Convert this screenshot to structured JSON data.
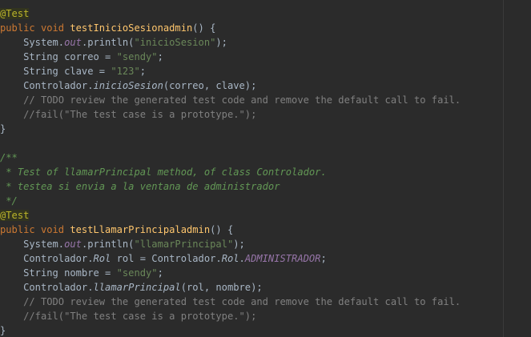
{
  "lines": [
    [
      {
        "t": "@Test",
        "c": "ann"
      }
    ],
    [
      {
        "t": "public void ",
        "c": "kw"
      },
      {
        "t": "testInicioSesionadmin",
        "c": "fn"
      },
      {
        "t": "() {",
        "c": ""
      }
    ],
    [
      {
        "t": "    System.",
        "c": ""
      },
      {
        "t": "out",
        "c": "fld"
      },
      {
        "t": ".println(",
        "c": ""
      },
      {
        "t": "\"inicioSesion\"",
        "c": "str"
      },
      {
        "t": ");",
        "c": ""
      }
    ],
    [
      {
        "t": "    String correo = ",
        "c": ""
      },
      {
        "t": "\"sendy\"",
        "c": "str"
      },
      {
        "t": ";",
        "c": ""
      }
    ],
    [
      {
        "t": "    String clave = ",
        "c": ""
      },
      {
        "t": "\"123\"",
        "c": "str"
      },
      {
        "t": ";",
        "c": ""
      }
    ],
    [
      {
        "t": "    Controlador.",
        "c": ""
      },
      {
        "t": "inicioSesion",
        "c": "stat"
      },
      {
        "t": "(correo, clave);",
        "c": ""
      }
    ],
    [
      {
        "t": "    // TODO review the generated test code and remove the default call to fail.",
        "c": "com"
      }
    ],
    [
      {
        "t": "    //fail(\"The test case is a prototype.\");",
        "c": "com"
      }
    ],
    [
      {
        "t": "}",
        "c": ""
      }
    ],
    [
      {
        "t": "",
        "c": ""
      }
    ],
    [
      {
        "t": "/**",
        "c": "doc"
      }
    ],
    [
      {
        "t": " * Test of llamarPrincipal method, of class Controlador.",
        "c": "doc"
      }
    ],
    [
      {
        "t": " * testea si envia a la ventana de administrador",
        "c": "doc"
      }
    ],
    [
      {
        "t": " */",
        "c": "doc"
      }
    ],
    [
      {
        "t": "@Test",
        "c": "ann"
      }
    ],
    [
      {
        "t": "public void ",
        "c": "kw"
      },
      {
        "t": "testLlamarPrincipaladmin",
        "c": "fn"
      },
      {
        "t": "() {",
        "c": ""
      }
    ],
    [
      {
        "t": "    System.",
        "c": ""
      },
      {
        "t": "out",
        "c": "fld"
      },
      {
        "t": ".println(",
        "c": ""
      },
      {
        "t": "\"llamarPrincipal\"",
        "c": "str"
      },
      {
        "t": ");",
        "c": ""
      }
    ],
    [
      {
        "t": "    Controlador.",
        "c": ""
      },
      {
        "t": "Rol",
        "c": "stat"
      },
      {
        "t": " rol = Controlador.",
        "c": ""
      },
      {
        "t": "Rol",
        "c": "stat"
      },
      {
        "t": ".",
        "c": ""
      },
      {
        "t": "ADMINISTRADOR",
        "c": "fld"
      },
      {
        "t": ";",
        "c": ""
      }
    ],
    [
      {
        "t": "    String nombre = ",
        "c": ""
      },
      {
        "t": "\"sendy\"",
        "c": "str"
      },
      {
        "t": ";",
        "c": ""
      }
    ],
    [
      {
        "t": "    Controlador.",
        "c": ""
      },
      {
        "t": "llamarPrincipal",
        "c": "stat"
      },
      {
        "t": "(rol, nombre);",
        "c": ""
      }
    ],
    [
      {
        "t": "    // TODO review the generated test code and remove the default call to fail.",
        "c": "com"
      }
    ],
    [
      {
        "t": "    //fail(\"The test case is a prototype.\");",
        "c": "com"
      }
    ],
    [
      {
        "t": "}",
        "c": ""
      }
    ]
  ]
}
